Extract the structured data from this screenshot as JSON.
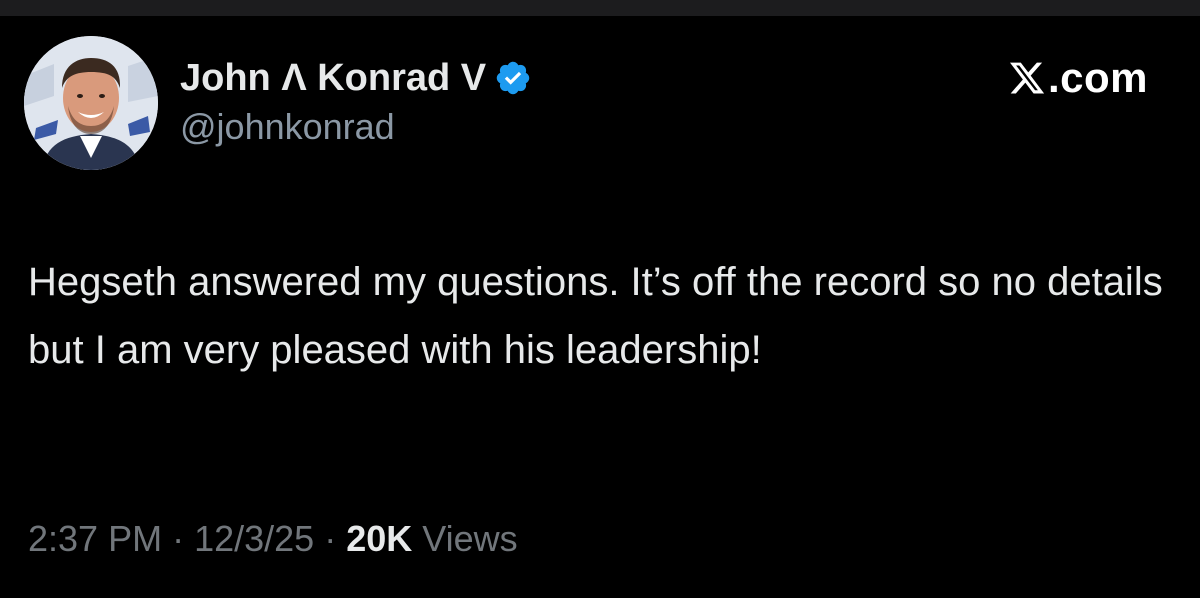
{
  "author": {
    "display_name": "John Λ Konrad V",
    "handle": "@johnkonrad",
    "verified": true,
    "avatar_icon": "profile-photo"
  },
  "brand": {
    "text": ".com",
    "icon": "x-logo-icon"
  },
  "tweet": {
    "text": "Hegseth answered my questions. It’s off the record so no details but I am very pleased with his leadership!"
  },
  "meta": {
    "time": "2:37 PM",
    "date": "12/3/25",
    "views_count": "20K",
    "views_label": "Views",
    "separator": "·"
  },
  "colors": {
    "background": "#000000",
    "text": "#e7e9ea",
    "secondary": "#71767b",
    "verified": "#1d9bf0"
  }
}
